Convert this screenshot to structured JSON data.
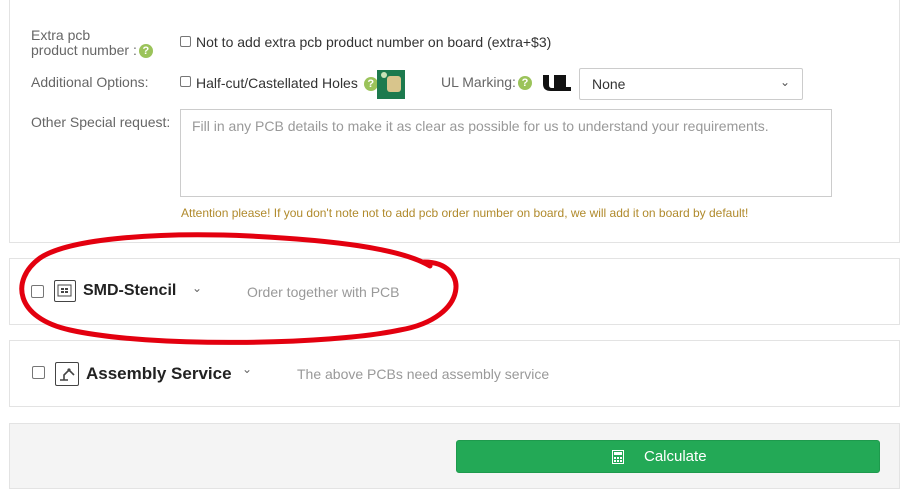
{
  "extra_pcb": {
    "label_line1": "Extra pcb",
    "label_line2": "product number :",
    "help": "?",
    "option_text": "Not to add extra pcb product number on board (extra+$3)"
  },
  "additional_options": {
    "label": "Additional Options:",
    "halfcut_text": "Half-cut/Castellated Holes",
    "help": "?"
  },
  "ul_marking": {
    "label": "UL Marking:",
    "help": "?",
    "selected": "None"
  },
  "special_request": {
    "label": "Other Special request:",
    "placeholder": "Fill in any PCB details to make it as clear as possible for us to understand your requirements."
  },
  "attention": "Attention please! If you don't note not to add pcb order number on board, we will add it on board by default!",
  "smd_stencil": {
    "title": "SMD-Stencil",
    "subtitle": "Order together with PCB"
  },
  "assembly": {
    "title": "Assembly Service",
    "subtitle": "The above PCBs need assembly service"
  },
  "calculate": {
    "label": "Calculate"
  },
  "colors": {
    "accent_green": "#23a956",
    "help_green": "#9bc35a",
    "attention_text": "#b08a2c",
    "annotation_red": "#e3000f"
  },
  "icons": {
    "help": "question-circle-icon",
    "ul": "ul-logo-icon",
    "stencil": "stencil-icon",
    "assembly": "assembly-robot-icon",
    "calculator": "calculator-icon",
    "chevron": "chevron-down-icon"
  }
}
